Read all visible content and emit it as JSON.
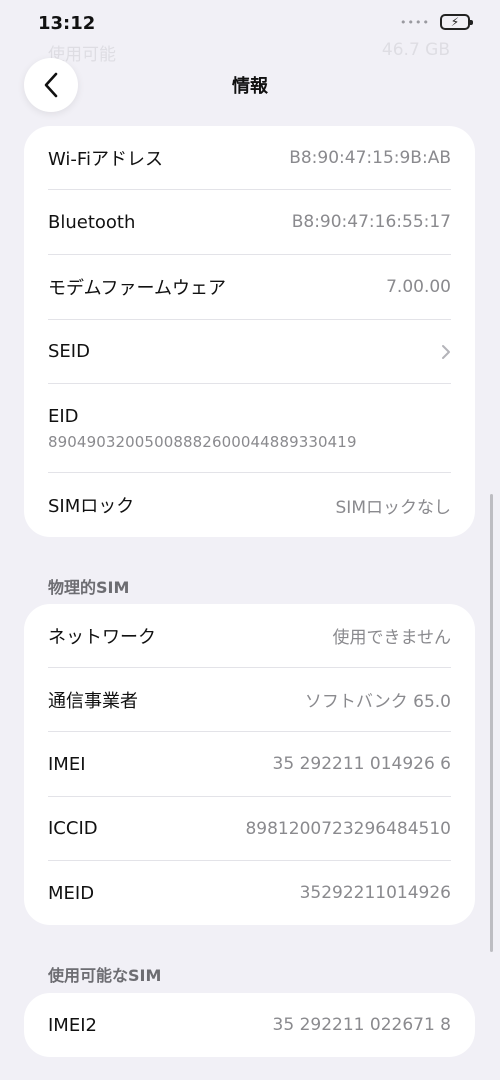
{
  "status_bar": {
    "time": "13:12",
    "signal": "••••"
  },
  "ghost_row": {
    "label": "使用可能",
    "value": "46.7 GB"
  },
  "nav": {
    "title": "情報"
  },
  "group1": [
    {
      "label": "Wi-Fiアドレス",
      "value": "B8:90:47:15:9B:AB"
    },
    {
      "label": "Bluetooth",
      "value": "B8:90:47:16:55:17"
    },
    {
      "label": "モデムファームウェア",
      "value": "7.00.00"
    },
    {
      "label": "SEID",
      "value": ""
    },
    {
      "label": "EID",
      "value": "89049032005008882600044889330419"
    },
    {
      "label": "SIMロック",
      "value": "SIMロックなし"
    }
  ],
  "section_physical_sim": "物理的SIM",
  "group2": [
    {
      "label": "ネットワーク",
      "value": "使用できません"
    },
    {
      "label": "通信事業者",
      "value": "ソフトバンク 65.0"
    },
    {
      "label": "IMEI",
      "value": "35 292211 014926 6"
    },
    {
      "label": "ICCID",
      "value": "8981200723296484510"
    },
    {
      "label": "MEID",
      "value": "35292211014926"
    }
  ],
  "section_available_sim": "使用可能なSIM",
  "group3": [
    {
      "label": "IMEI2",
      "value": "35 292211 022671 8"
    }
  ],
  "icons": {
    "back": "chevron-left-icon",
    "disclosure": "chevron-right-icon",
    "battery": "battery-charging-icon"
  }
}
